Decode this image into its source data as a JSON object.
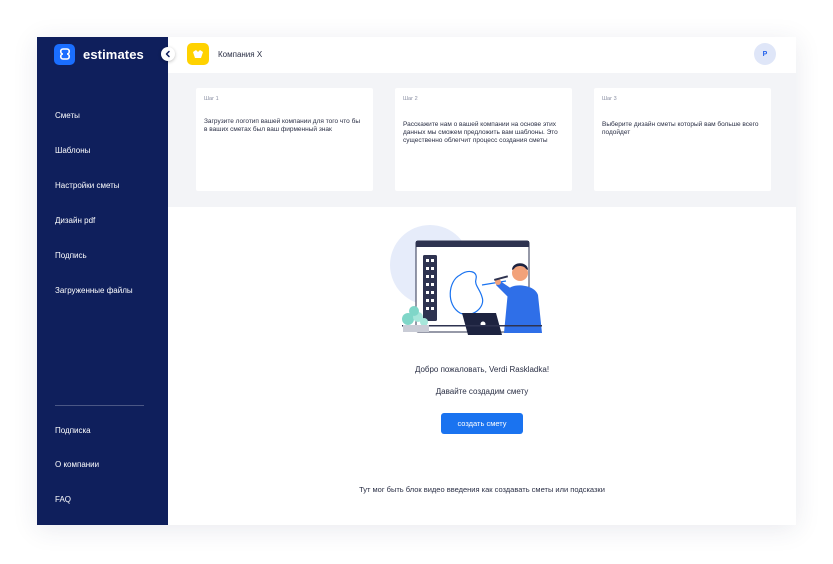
{
  "sidebar": {
    "brand": "estimates",
    "items": [
      {
        "label": "Сметы"
      },
      {
        "label": "Шаблоны"
      },
      {
        "label": "Настройки сметы"
      },
      {
        "label": "Дизайн pdf"
      },
      {
        "label": "Подпись"
      },
      {
        "label": "Загруженные файлы"
      }
    ],
    "bottom_items": [
      {
        "label": "Подписка"
      },
      {
        "label": "О компании"
      },
      {
        "label": "FAQ"
      }
    ]
  },
  "topbar": {
    "company_name": "Компания X",
    "avatar_initial": "P"
  },
  "steps": [
    {
      "label": "Шаг 1",
      "text": "Загрузите логотип вашей компании для того что бы в ваших сметах был ваш фирменный знак"
    },
    {
      "label": "Шаг 2",
      "text": "Расскажите нам о вашей компании на основе этих данных мы сможем предложить вам шаблоны. Это существенно облегчит процесс создания сметы"
    },
    {
      "label": "Шаг 3",
      "text": "Выберите дизайн сметы который вам больше всего подойдет"
    }
  ],
  "main": {
    "welcome": "Добро пожаловать, Verdi Raskladka!",
    "subtitle": "Давайте создадим смету",
    "create_button": "создать смету",
    "video_hint": "Тут мог быть блок видео введения как создавать сметы или подсказки"
  },
  "icons": {
    "brand": "estimates-logo-icon",
    "collapse": "chevron-left-icon",
    "company": "company-logo-icon",
    "notifications": "bell-icon"
  },
  "colors": {
    "sidebar": "#0f1f5c",
    "accent": "#1a73f0",
    "company_logo": "#ffd200",
    "background": "#f3f4f7"
  }
}
